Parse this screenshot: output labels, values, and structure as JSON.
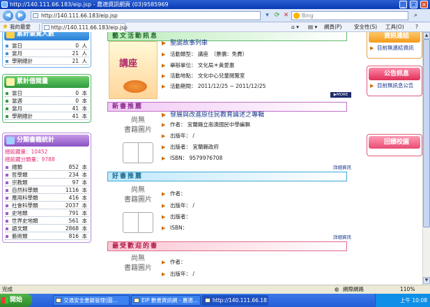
{
  "window": {
    "title": "http://140.111.66.183/eip.jsp - 農適資訊網頁 (03)9585969"
  },
  "address": {
    "url": "http://140.111.66.183/eip.jsp",
    "search_placeholder": "Bing"
  },
  "toolbar": {
    "favorites": "我的最愛",
    "tab_label": "http://140.111.66.183/eip.jsp",
    "page": "網頁(P)",
    "safety": "安全性(S)",
    "tools": "工具(O)"
  },
  "left": {
    "visitors": {
      "title": "累計瀏覽人數",
      "rows": [
        {
          "label": "當日",
          "value": "0",
          "unit": "人"
        },
        {
          "label": "當月",
          "value": "21",
          "unit": "人"
        },
        {
          "label": "學期總計",
          "value": "21",
          "unit": "人"
        }
      ]
    },
    "views": {
      "title": "累計借閱量",
      "rows": [
        {
          "label": "當日",
          "value": "0",
          "unit": "本"
        },
        {
          "label": "當週",
          "value": "0",
          "unit": "本"
        },
        {
          "label": "當月",
          "value": "41",
          "unit": "本"
        },
        {
          "label": "學期總計",
          "value": "41",
          "unit": "本"
        }
      ]
    },
    "categories": {
      "title": "分類書籍統計",
      "total": "總館藏量：10452",
      "classified": "總館藏分類量：9788",
      "rows": [
        {
          "label": "總類",
          "value": "852",
          "unit": "本"
        },
        {
          "label": "哲學類",
          "value": "234",
          "unit": "本"
        },
        {
          "label": "宗教類",
          "value": "97",
          "unit": "本"
        },
        {
          "label": "自然科學類",
          "value": "1116",
          "unit": "本"
        },
        {
          "label": "應用科學類",
          "value": "416",
          "unit": "本"
        },
        {
          "label": "社會科學類",
          "value": "2037",
          "unit": "本"
        },
        {
          "label": "史地類",
          "value": "791",
          "unit": "本"
        },
        {
          "label": "世界史地類",
          "value": "561",
          "unit": "本"
        },
        {
          "label": "語文類",
          "value": "2868",
          "unit": "本"
        },
        {
          "label": "藝術類",
          "value": "816",
          "unit": "本"
        }
      ]
    }
  },
  "center": {
    "events": {
      "title": "藝文活動訊息",
      "poster_text": "講座",
      "item_title": "聖誕故事列車",
      "rows": [
        "活動類型： 講座　（票價：免費）",
        "舉辦單位： 文化局＊黃愛惠",
        "活動地點： 文化中心兒童閱覽室",
        "活動期間： 2011/12/25 ~ 2011/12/25"
      ],
      "more": "MORE"
    },
    "newbooks": {
      "title": "新書推薦",
      "no_image": [
        "尚無",
        "書籍圖片"
      ],
      "book_title": "發展與改進原住民教育論述之專輯",
      "rows": [
        "作者： 宜蘭縣立南澳國民中學編輯",
        "出版年： /",
        "出版者： 宜蘭縣政府",
        "ISBN： 9579976708"
      ],
      "more": "詳細資訊"
    },
    "goodbooks": {
      "title": "好書推薦",
      "no_image": [
        "尚無",
        "書籍圖片"
      ],
      "rows": [
        "作者：",
        "出版年： /",
        "出版者：",
        "ISBN："
      ],
      "more": "詳細資訊"
    },
    "popular": {
      "title": "最受歡迎的書",
      "no_image": [
        "尚無",
        "書籍圖片"
      ],
      "rows": [
        "作者：",
        "出版年： /"
      ]
    }
  },
  "right": {
    "resources": {
      "title": "資訊連結",
      "text": "目前無連結資訊"
    },
    "notice": {
      "title": "公告訊息",
      "text": "目前無訊息公告"
    },
    "feedback": {
      "title": "回饋校園"
    }
  },
  "status": {
    "left": "完成",
    "zone": "網際網路",
    "zoom": "110%"
  },
  "taskbar": {
    "start": "開始",
    "tasks": [
      "交通安全書籍管理(圖...",
      "EIP 數書資訊網 - 農適...",
      "http://140.111.66.183/eip..."
    ],
    "clock": "上午 10:08"
  }
}
